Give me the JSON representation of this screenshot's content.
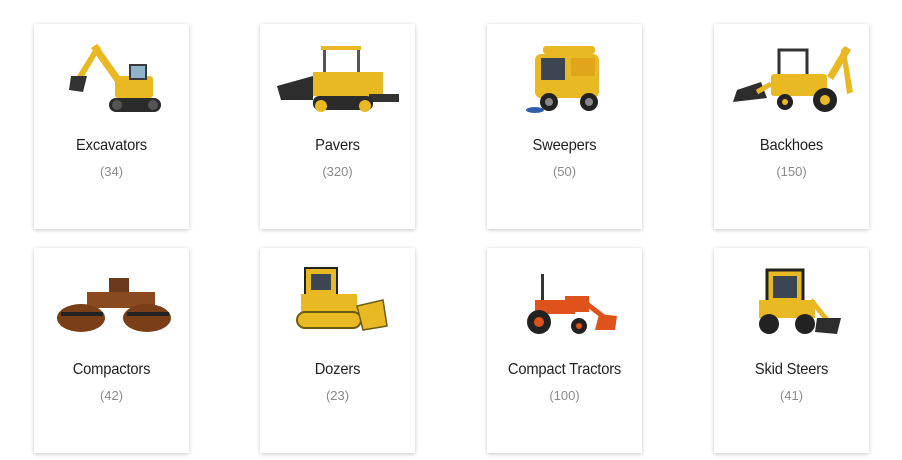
{
  "categories": [
    {
      "title": "Excavators",
      "count": "(34)",
      "icon": "excavator-icon"
    },
    {
      "title": "Pavers",
      "count": "(320)",
      "icon": "paver-icon"
    },
    {
      "title": "Sweepers",
      "count": "(50)",
      "icon": "sweeper-icon"
    },
    {
      "title": "Backhoes",
      "count": "(150)",
      "icon": "backhoe-icon"
    },
    {
      "title": "Compactors",
      "count": "(42)",
      "icon": "compactor-icon"
    },
    {
      "title": "Dozers",
      "count": "(23)",
      "icon": "dozer-icon"
    },
    {
      "title": "Compact Tractors",
      "count": "(100)",
      "icon": "compact-tractor-icon"
    },
    {
      "title": "Skid Steers",
      "count": "(41)",
      "icon": "skid-steer-icon"
    }
  ],
  "colors": {
    "machine_yellow": "#e8b923",
    "tractor_orange": "#e0521b",
    "compactor_brown": "#8a4a20",
    "title_text": "#1f1f1f",
    "count_text": "#8a8a8a"
  }
}
